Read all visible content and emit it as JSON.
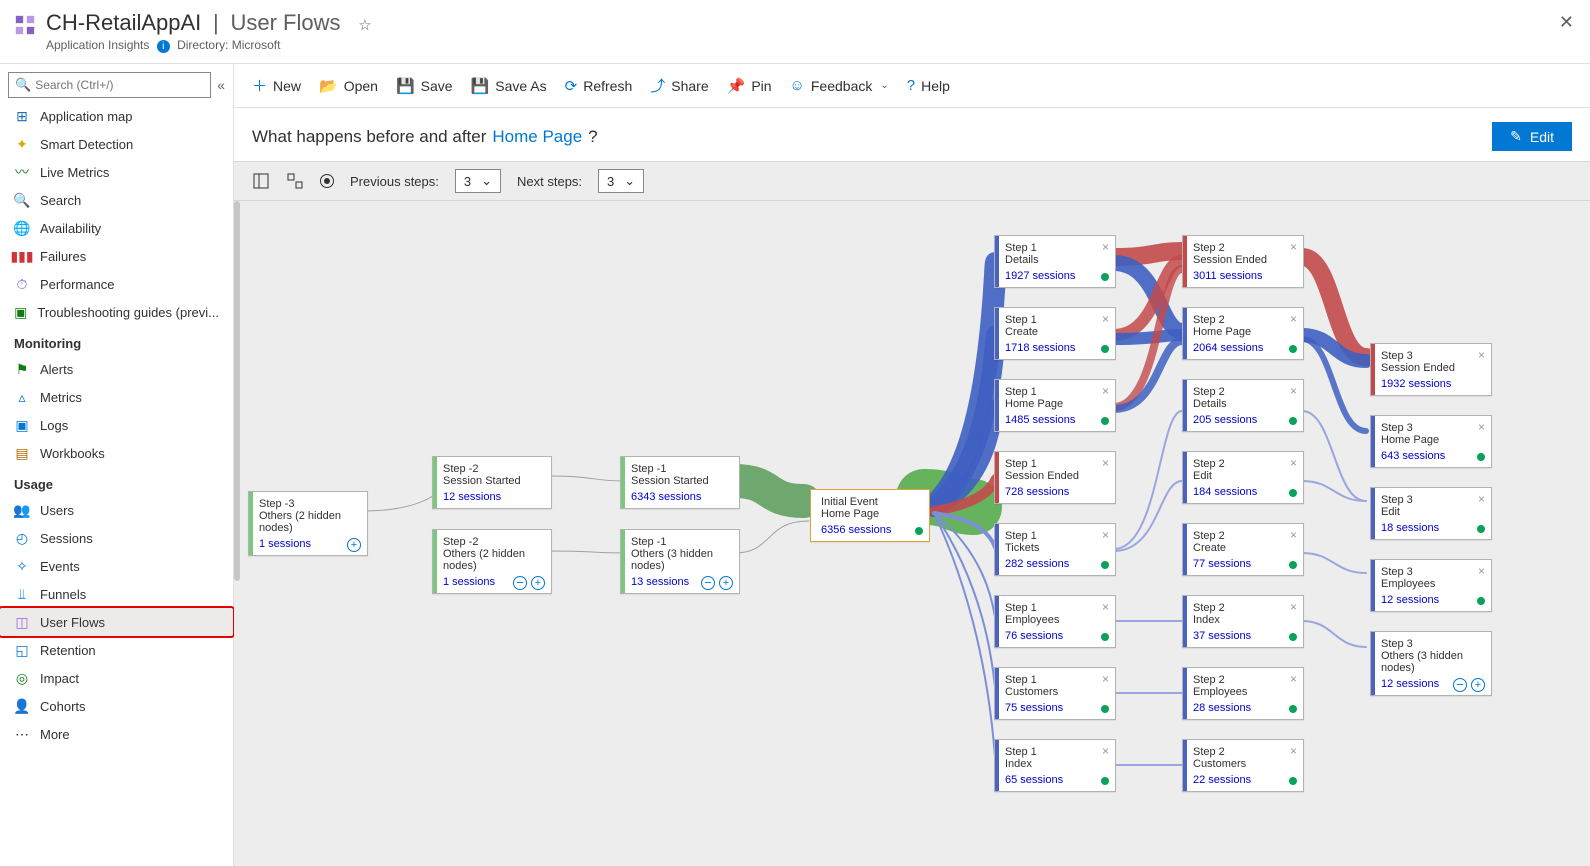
{
  "header": {
    "app_name": "CH-RetailAppAI",
    "page_name": "User Flows",
    "resource_type": "Application Insights",
    "directory_label": "Directory: Microsoft"
  },
  "search": {
    "placeholder": "Search (Ctrl+/)"
  },
  "nav": {
    "items_top": [
      {
        "label": "Application map",
        "icon": "⊞",
        "color": "#1f6db1"
      },
      {
        "label": "Smart Detection",
        "icon": "✦",
        "color": "#d6aa00"
      },
      {
        "label": "Live Metrics",
        "icon": "〰",
        "color": "#107c10"
      },
      {
        "label": "Search",
        "icon": "🔍",
        "color": "#323130"
      },
      {
        "label": "Availability",
        "icon": "🌐",
        "color": "#0aa15b"
      },
      {
        "label": "Failures",
        "icon": "▮▮▮",
        "color": "#d13438"
      },
      {
        "label": "Performance",
        "icon": "⏱",
        "color": "#6b69d6"
      },
      {
        "label": "Troubleshooting guides (previ...",
        "icon": "▣",
        "color": "#107c10"
      }
    ],
    "section_monitoring": "Monitoring",
    "items_monitoring": [
      {
        "label": "Alerts",
        "icon": "⚑",
        "color": "#107c10"
      },
      {
        "label": "Metrics",
        "icon": "▵",
        "color": "#0078d4"
      },
      {
        "label": "Logs",
        "icon": "▣",
        "color": "#0078d4"
      },
      {
        "label": "Workbooks",
        "icon": "▤",
        "color": "#b36b00"
      }
    ],
    "section_usage": "Usage",
    "items_usage": [
      {
        "label": "Users",
        "icon": "👥",
        "color": "#605e5c"
      },
      {
        "label": "Sessions",
        "icon": "◴",
        "color": "#0078d4"
      },
      {
        "label": "Events",
        "icon": "✧",
        "color": "#0078d4"
      },
      {
        "label": "Funnels",
        "icon": "⫫",
        "color": "#0078d4"
      },
      {
        "label": "User Flows",
        "icon": "◫",
        "color": "#9b6bdc",
        "selected": true
      },
      {
        "label": "Retention",
        "icon": "◱",
        "color": "#0078d4"
      },
      {
        "label": "Impact",
        "icon": "◎",
        "color": "#107c10"
      },
      {
        "label": "Cohorts",
        "icon": "👤",
        "color": "#0078d4"
      },
      {
        "label": "More",
        "icon": "⋯",
        "color": "#323130"
      }
    ]
  },
  "toolbar": {
    "new": "New",
    "open": "Open",
    "save": "Save",
    "saveas": "Save As",
    "refresh": "Refresh",
    "share": "Share",
    "pin": "Pin",
    "feedback": "Feedback",
    "help": "Help"
  },
  "question": {
    "prefix": "What happens before and after",
    "link": "Home Page",
    "suffix": "?"
  },
  "edit_label": "Edit",
  "controls": {
    "prev_label": "Previous steps:",
    "prev_val": "3",
    "next_label": "Next steps:",
    "next_val": "3"
  },
  "nodes": {
    "n_m3": {
      "step": "Step -3",
      "name": "Others (2 hidden nodes)",
      "sess": "1 sessions"
    },
    "n_m2a": {
      "step": "Step -2",
      "name": "Session Started",
      "sess": "12 sessions"
    },
    "n_m2b": {
      "step": "Step -2",
      "name": "Others (2 hidden nodes)",
      "sess": "1 sessions"
    },
    "n_m1a": {
      "step": "Step -1",
      "name": "Session Started",
      "sess": "6343 sessions"
    },
    "n_m1b": {
      "step": "Step -1",
      "name": "Others (3 hidden nodes)",
      "sess": "13 sessions"
    },
    "n_init": {
      "step": "Initial Event",
      "name": "Home Page",
      "sess": "6356 sessions"
    },
    "s1_details": {
      "step": "Step 1",
      "name": "Details",
      "sess": "1927 sessions"
    },
    "s1_create": {
      "step": "Step 1",
      "name": "Create",
      "sess": "1718 sessions"
    },
    "s1_home": {
      "step": "Step 1",
      "name": "Home Page",
      "sess": "1485 sessions"
    },
    "s1_ended": {
      "step": "Step 1",
      "name": "Session Ended",
      "sess": "728 sessions"
    },
    "s1_tickets": {
      "step": "Step 1",
      "name": "Tickets",
      "sess": "282 sessions"
    },
    "s1_emp": {
      "step": "Step 1",
      "name": "Employees",
      "sess": "76 sessions"
    },
    "s1_cust": {
      "step": "Step 1",
      "name": "Customers",
      "sess": "75 sessions"
    },
    "s1_index": {
      "step": "Step 1",
      "name": "Index",
      "sess": "65 sessions"
    },
    "s2_ended": {
      "step": "Step 2",
      "name": "Session Ended",
      "sess": "3011 sessions"
    },
    "s2_home": {
      "step": "Step 2",
      "name": "Home Page",
      "sess": "2064 sessions"
    },
    "s2_details": {
      "step": "Step 2",
      "name": "Details",
      "sess": "205 sessions"
    },
    "s2_edit": {
      "step": "Step 2",
      "name": "Edit",
      "sess": "184 sessions"
    },
    "s2_create": {
      "step": "Step 2",
      "name": "Create",
      "sess": "77 sessions"
    },
    "s2_index": {
      "step": "Step 2",
      "name": "Index",
      "sess": "37 sessions"
    },
    "s2_emp": {
      "step": "Step 2",
      "name": "Employees",
      "sess": "28 sessions"
    },
    "s2_cust": {
      "step": "Step 2",
      "name": "Customers",
      "sess": "22 sessions"
    },
    "s3_ended": {
      "step": "Step 3",
      "name": "Session Ended",
      "sess": "1932 sessions"
    },
    "s3_home": {
      "step": "Step 3",
      "name": "Home Page",
      "sess": "643 sessions"
    },
    "s3_edit": {
      "step": "Step 3",
      "name": "Edit",
      "sess": "18 sessions"
    },
    "s3_emp": {
      "step": "Step 3",
      "name": "Employees",
      "sess": "12 sessions"
    },
    "s3_others": {
      "step": "Step 3",
      "name": "Others (3 hidden nodes)",
      "sess": "12 sessions"
    }
  }
}
